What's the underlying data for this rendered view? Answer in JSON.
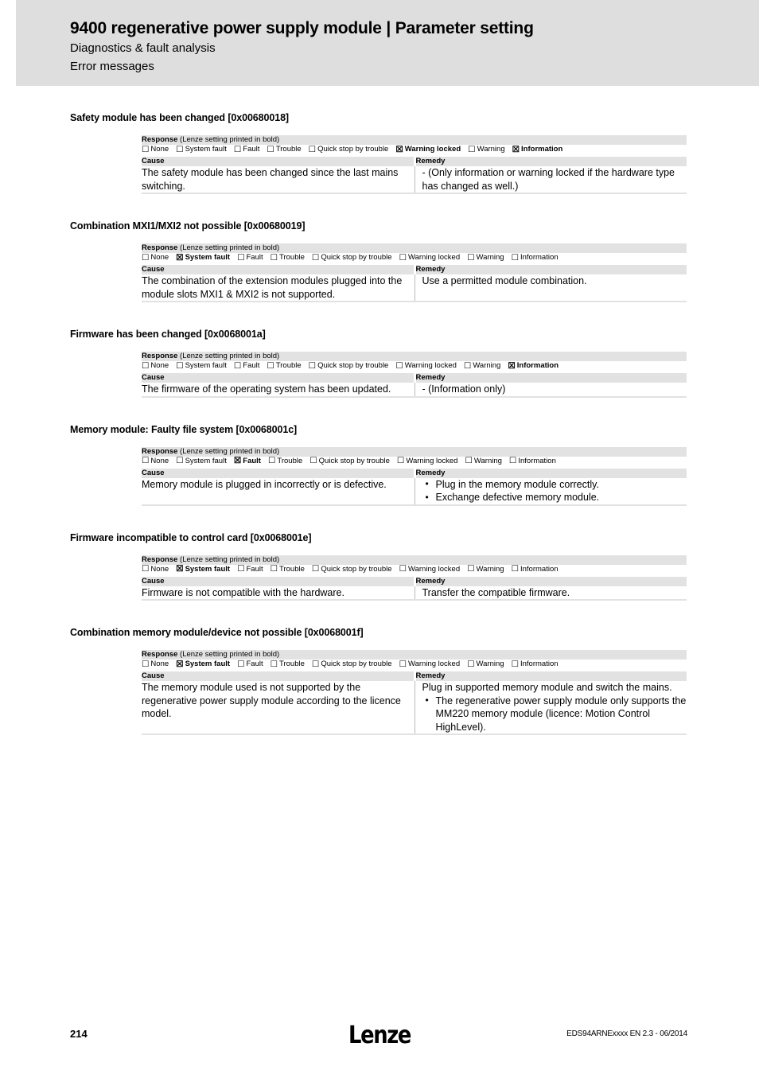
{
  "header": {
    "title": "9400 regenerative power supply module | Parameter setting",
    "subtitle_1": "Diagnostics & fault analysis",
    "subtitle_2": "Error messages"
  },
  "labels": {
    "response_label": "Response",
    "response_note": " (Lenze setting printed in bold)",
    "cause_header": "Cause",
    "remedy_header": "Remedy",
    "checkbox_checked": "☒",
    "checkbox_unchecked": "☐"
  },
  "response_options": [
    "None",
    "System fault",
    "Fault",
    "Trouble",
    "Quick stop by trouble",
    "Warning locked",
    "Warning",
    "Information"
  ],
  "blocks": [
    {
      "heading": "Safety module has been changed [0x00680018]",
      "checked": [
        false,
        false,
        false,
        false,
        false,
        true,
        false,
        true
      ],
      "cause": "The safety module has been changed since the last mains switching.",
      "remedy_text": "- (Only information or warning locked if the hardware type has changed as well.)",
      "remedy_bullets": []
    },
    {
      "heading": "Combination MXI1/MXI2 not possible [0x00680019]",
      "checked": [
        false,
        true,
        false,
        false,
        false,
        false,
        false,
        false
      ],
      "cause": "The combination of the extension modules plugged into the module slots MXI1 & MXI2 is not supported.",
      "remedy_text": "Use a permitted module combination.",
      "remedy_bullets": []
    },
    {
      "heading": "Firmware has been changed [0x0068001a]",
      "checked": [
        false,
        false,
        false,
        false,
        false,
        false,
        false,
        true
      ],
      "cause": "The firmware of the operating system has been updated.",
      "remedy_text": "- (Information only)",
      "remedy_bullets": []
    },
    {
      "heading": "Memory module: Faulty file system [0x0068001c]",
      "checked": [
        false,
        false,
        true,
        false,
        false,
        false,
        false,
        false
      ],
      "cause": "Memory module is plugged in incorrectly or is defective.",
      "remedy_text": "",
      "remedy_bullets": [
        "Plug in the memory module correctly.",
        "Exchange defective memory module."
      ]
    },
    {
      "heading": "Firmware incompatible to control card [0x0068001e]",
      "checked": [
        false,
        true,
        false,
        false,
        false,
        false,
        false,
        false
      ],
      "cause": "Firmware is not compatible with the hardware.",
      "remedy_text": "Transfer the compatible firmware.",
      "remedy_bullets": []
    },
    {
      "heading": "Combination memory module/device not possible [0x0068001f]",
      "checked": [
        false,
        true,
        false,
        false,
        false,
        false,
        false,
        false
      ],
      "cause": "The memory module used is not supported by the regenerative power supply module according to the licence model.",
      "remedy_text": "Plug in supported memory module and switch the mains.",
      "remedy_bullets": [
        "The regenerative power supply module only supports the MM220 memory module (licence: Motion Control HighLevel)."
      ]
    }
  ],
  "footer": {
    "page_number": "214",
    "logo_text": "Lenze",
    "doc_reference": "EDS94ARNExxxx EN 2.3 - 06/2014"
  }
}
